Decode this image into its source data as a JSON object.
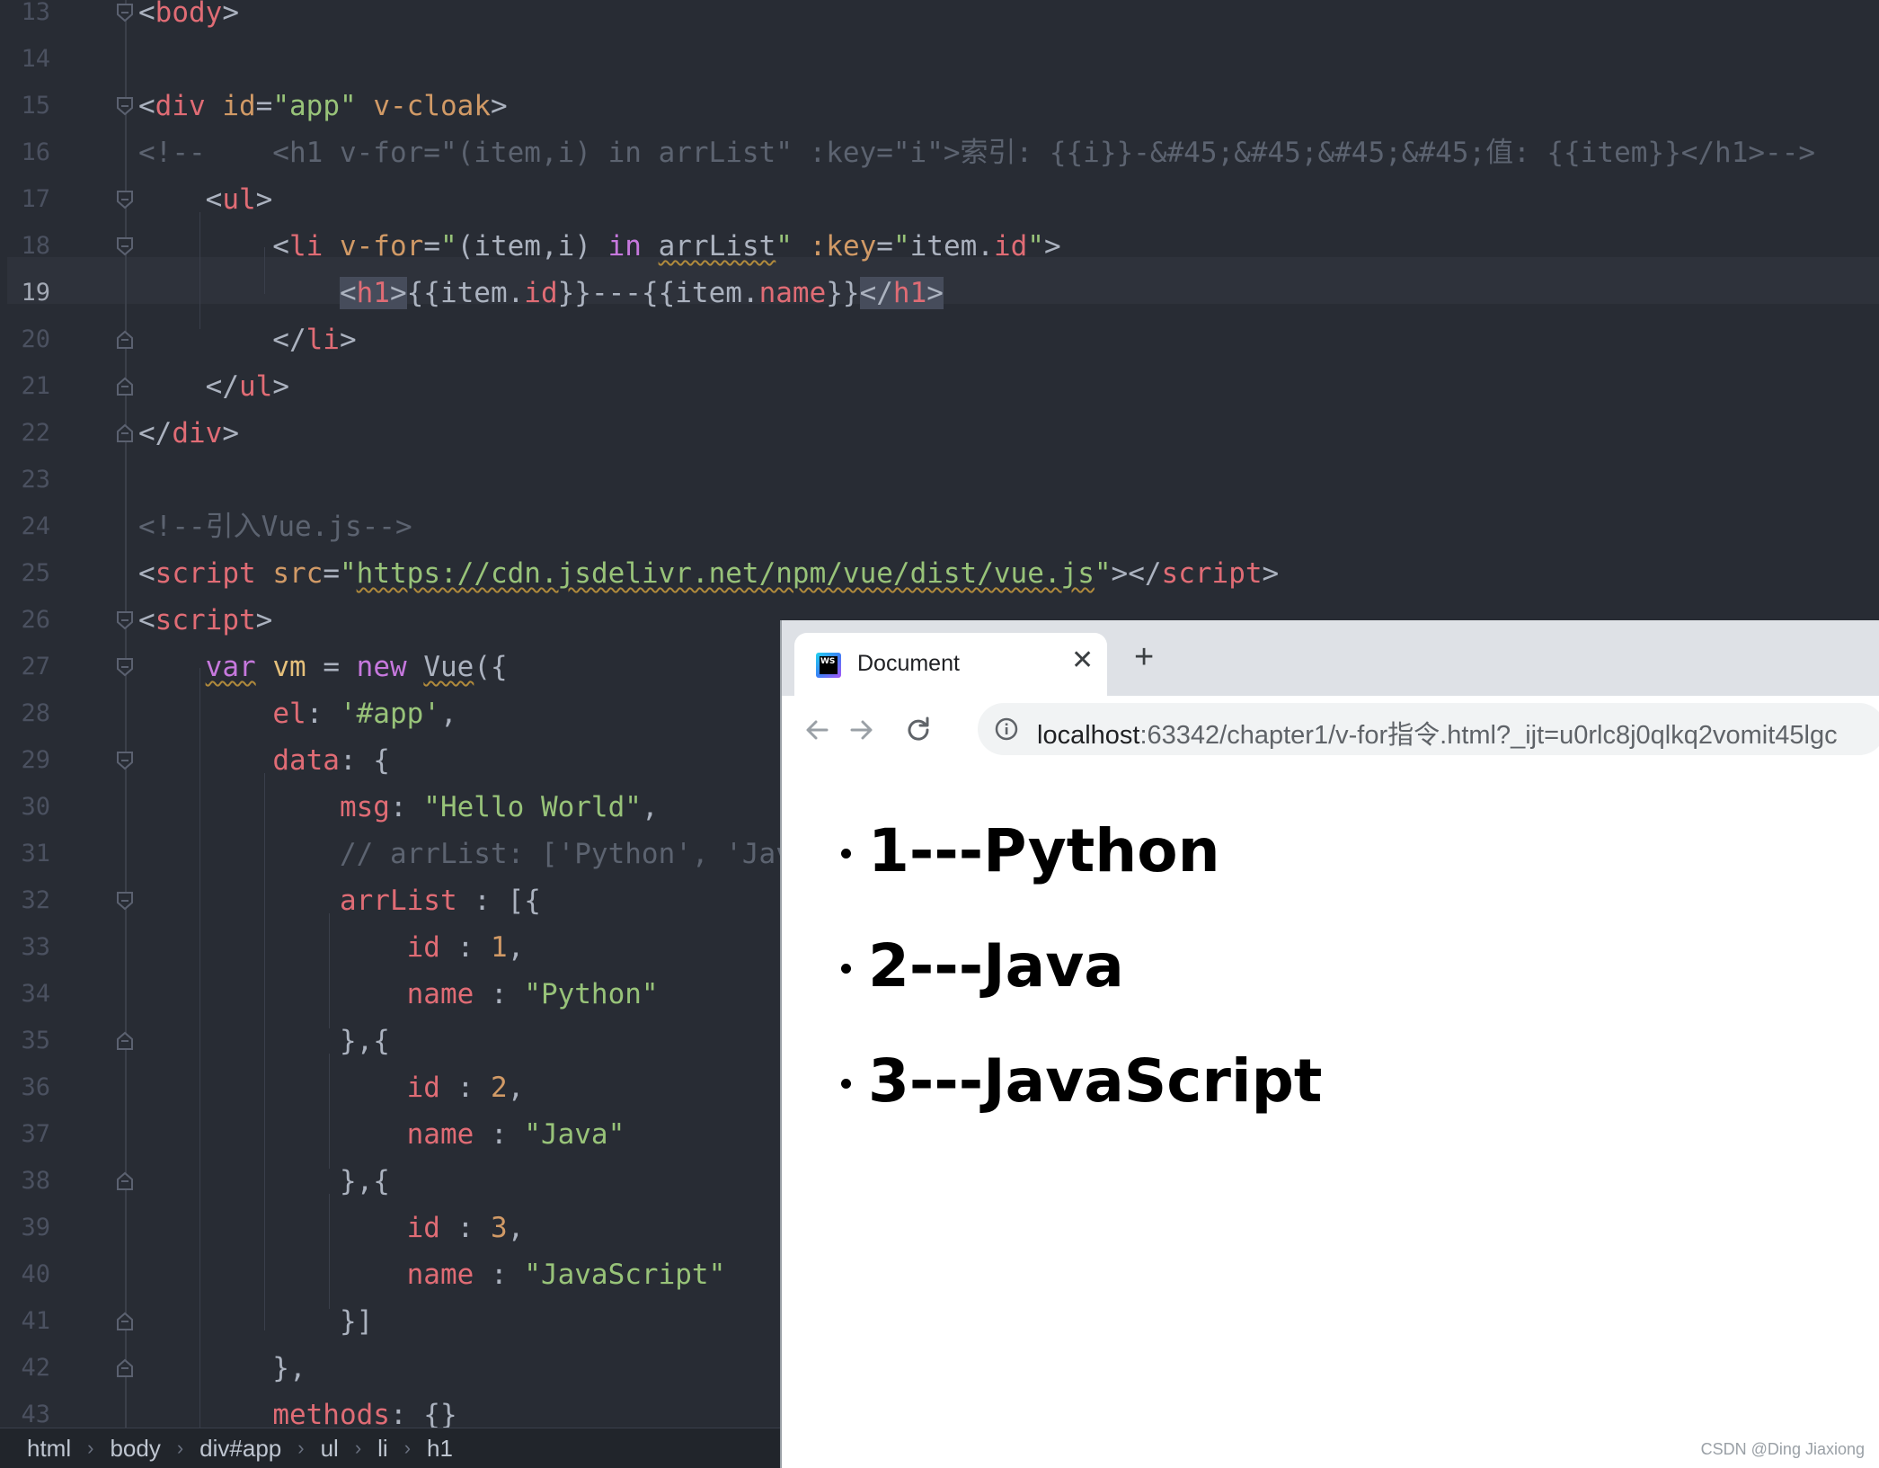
{
  "editor": {
    "active_line": 19,
    "lines": [
      {
        "n": 13,
        "fold": "open",
        "partial": true,
        "segs": [
          [
            "punct",
            "<"
          ],
          [
            "tag",
            "body"
          ],
          [
            "punct",
            ">"
          ]
        ]
      },
      {
        "n": 14,
        "segs": []
      },
      {
        "n": 15,
        "fold": "open",
        "segs": [
          [
            "punct",
            "<"
          ],
          [
            "tag",
            "div"
          ],
          [
            "punct",
            " "
          ],
          [
            "attr",
            "id"
          ],
          [
            "punct",
            "="
          ],
          [
            "str",
            "\"app\""
          ],
          [
            "punct",
            " "
          ],
          [
            "attr",
            "v-cloak"
          ],
          [
            "punct",
            ">"
          ]
        ]
      },
      {
        "n": 16,
        "segs": [
          [
            "cmt",
            "<!--    <h1 v-for=\"(item,i) in arrList\" :key=\"i\">索引: {{i}}-&#45;&#45;&#45;&#45;值: {{item}}</h1>-->"
          ]
        ]
      },
      {
        "n": 17,
        "fold": "open",
        "segs": [
          [
            "punct",
            "    <"
          ],
          [
            "tag",
            "ul"
          ],
          [
            "punct",
            ">"
          ]
        ]
      },
      {
        "n": 18,
        "fold": "open",
        "segs": [
          [
            "punct",
            "        <"
          ],
          [
            "tag",
            "li"
          ],
          [
            "punct",
            " "
          ],
          [
            "attr",
            "v-for"
          ],
          [
            "punct",
            "="
          ],
          [
            "str",
            "\""
          ],
          [
            "punct",
            "(item,i) "
          ],
          [
            "kw",
            "in"
          ],
          [
            "punct",
            " "
          ],
          [
            "squig",
            "arrList"
          ],
          [
            "str",
            "\""
          ],
          [
            "punct",
            " "
          ],
          [
            "attr",
            ":key"
          ],
          [
            "punct",
            "="
          ],
          [
            "str",
            "\""
          ],
          [
            "punct",
            "item."
          ],
          [
            "prop",
            "id"
          ],
          [
            "str",
            "\""
          ],
          [
            "punct",
            ">"
          ]
        ]
      },
      {
        "n": 19,
        "segs": [
          [
            "punct",
            "            "
          ],
          [
            "hl",
            "<"
          ],
          [
            "hltag",
            "h1"
          ],
          [
            "hl",
            ">"
          ],
          [
            "punct",
            "{{item."
          ],
          [
            "prop",
            "id"
          ],
          [
            "punct",
            "}}---{{item."
          ],
          [
            "prop",
            "name"
          ],
          [
            "punct",
            "}}"
          ],
          [
            "hl",
            "</"
          ],
          [
            "hltag",
            "h1"
          ],
          [
            "hl",
            ">"
          ]
        ]
      },
      {
        "n": 20,
        "fold": "close",
        "segs": [
          [
            "punct",
            "        </"
          ],
          [
            "tag",
            "li"
          ],
          [
            "punct",
            ">"
          ]
        ]
      },
      {
        "n": 21,
        "fold": "close",
        "segs": [
          [
            "punct",
            "    </"
          ],
          [
            "tag",
            "ul"
          ],
          [
            "punct",
            ">"
          ]
        ]
      },
      {
        "n": 22,
        "fold": "close",
        "segs": [
          [
            "punct",
            "</"
          ],
          [
            "tag",
            "div"
          ],
          [
            "punct",
            ">"
          ]
        ]
      },
      {
        "n": 23,
        "segs": []
      },
      {
        "n": 24,
        "segs": [
          [
            "cmt",
            "<!--引入Vue.js-->"
          ]
        ]
      },
      {
        "n": 25,
        "segs": [
          [
            "punct",
            "<"
          ],
          [
            "tag",
            "script"
          ],
          [
            "punct",
            " "
          ],
          [
            "attr",
            "src"
          ],
          [
            "punct",
            "="
          ],
          [
            "str",
            "\""
          ],
          [
            "link",
            "https://cdn.jsdelivr.net/npm/vue/dist/vue.js"
          ],
          [
            "str",
            "\""
          ],
          [
            "punct",
            "></"
          ],
          [
            "tag",
            "script"
          ],
          [
            "punct",
            ">"
          ]
        ]
      },
      {
        "n": 26,
        "fold": "open",
        "segs": [
          [
            "punct",
            "<"
          ],
          [
            "tag",
            "script"
          ],
          [
            "punct",
            ">"
          ]
        ]
      },
      {
        "n": 27,
        "fold": "open",
        "segs": [
          [
            "punct",
            "    "
          ],
          [
            "kwsq",
            "var"
          ],
          [
            "punct",
            " "
          ],
          [
            "var",
            "vm"
          ],
          [
            "punct",
            " = "
          ],
          [
            "kw",
            "new"
          ],
          [
            "punct",
            " "
          ],
          [
            "squigp",
            "Vue"
          ],
          [
            "punct",
            "({"
          ]
        ]
      },
      {
        "n": 28,
        "segs": [
          [
            "punct",
            "        "
          ],
          [
            "prop",
            "el"
          ],
          [
            "punct",
            ": "
          ],
          [
            "str",
            "'#app'"
          ],
          [
            "punct",
            ","
          ]
        ]
      },
      {
        "n": 29,
        "fold": "open",
        "segs": [
          [
            "punct",
            "        "
          ],
          [
            "prop",
            "data"
          ],
          [
            "punct",
            ": {"
          ]
        ]
      },
      {
        "n": 30,
        "segs": [
          [
            "punct",
            "            "
          ],
          [
            "prop",
            "msg"
          ],
          [
            "punct",
            ": "
          ],
          [
            "str",
            "\"Hello World\""
          ],
          [
            "punct",
            ","
          ]
        ]
      },
      {
        "n": 31,
        "segs": [
          [
            "punct",
            "            "
          ],
          [
            "cmt",
            "// arrList: ['Python', 'Java"
          ]
        ]
      },
      {
        "n": 32,
        "fold": "open",
        "segs": [
          [
            "punct",
            "            "
          ],
          [
            "prop",
            "arrList"
          ],
          [
            "punct",
            " : [{"
          ]
        ]
      },
      {
        "n": 33,
        "segs": [
          [
            "punct",
            "                "
          ],
          [
            "prop",
            "id"
          ],
          [
            "punct",
            " : "
          ],
          [
            "num",
            "1"
          ],
          [
            "punct",
            ","
          ]
        ]
      },
      {
        "n": 34,
        "segs": [
          [
            "punct",
            "                "
          ],
          [
            "prop",
            "name"
          ],
          [
            "punct",
            " : "
          ],
          [
            "str",
            "\"Python\""
          ]
        ]
      },
      {
        "n": 35,
        "fold": "close",
        "segs": [
          [
            "punct",
            "            },{"
          ]
        ]
      },
      {
        "n": 36,
        "segs": [
          [
            "punct",
            "                "
          ],
          [
            "prop",
            "id"
          ],
          [
            "punct",
            " : "
          ],
          [
            "num",
            "2"
          ],
          [
            "punct",
            ","
          ]
        ]
      },
      {
        "n": 37,
        "segs": [
          [
            "punct",
            "                "
          ],
          [
            "prop",
            "name"
          ],
          [
            "punct",
            " : "
          ],
          [
            "str",
            "\"Java\""
          ]
        ]
      },
      {
        "n": 38,
        "fold": "close",
        "segs": [
          [
            "punct",
            "            },{"
          ]
        ]
      },
      {
        "n": 39,
        "segs": [
          [
            "punct",
            "                "
          ],
          [
            "prop",
            "id"
          ],
          [
            "punct",
            " : "
          ],
          [
            "num",
            "3"
          ],
          [
            "punct",
            ","
          ]
        ]
      },
      {
        "n": 40,
        "segs": [
          [
            "punct",
            "                "
          ],
          [
            "prop",
            "name"
          ],
          [
            "punct",
            " : "
          ],
          [
            "str",
            "\"JavaScript\""
          ]
        ]
      },
      {
        "n": 41,
        "fold": "close",
        "segs": [
          [
            "punct",
            "            }]"
          ]
        ]
      },
      {
        "n": 42,
        "fold": "close",
        "segs": [
          [
            "punct",
            "        },"
          ]
        ]
      },
      {
        "n": 43,
        "segs": [
          [
            "punct",
            "        "
          ],
          [
            "prop",
            "methods"
          ],
          [
            "punct",
            ": {}"
          ]
        ]
      }
    ]
  },
  "breadcrumb": {
    "items": [
      "html",
      "body",
      "div#app",
      "ul",
      "li",
      "h1"
    ],
    "separator": "›"
  },
  "browser": {
    "tab_title": "Document",
    "tab_icon_text": "WS",
    "close_glyph": "✕",
    "new_tab_glyph": "+",
    "url_host": "localhost",
    "url_rest": ":63342/chapter1/v-for指令.html?_ijt=u0rlc8j0qlkq2vomit45lgc",
    "results": [
      "1---Python",
      "2---Java",
      "3---JavaScript"
    ]
  },
  "watermark": "CSDN @Ding Jiaxiong",
  "icons": {
    "tab_favicon": "webstorm-icon",
    "nav_back": "back-arrow-icon",
    "nav_forward": "forward-arrow-icon",
    "nav_reload": "reload-icon",
    "site_info": "info-icon"
  },
  "colors": {
    "editor_bg": "#282c34",
    "tag": "#e06c75",
    "attr": "#d19a66",
    "string": "#98c379",
    "keyword": "#c678dd",
    "comment": "#5c6370",
    "browser_tab_strip": "#dee1e6"
  }
}
